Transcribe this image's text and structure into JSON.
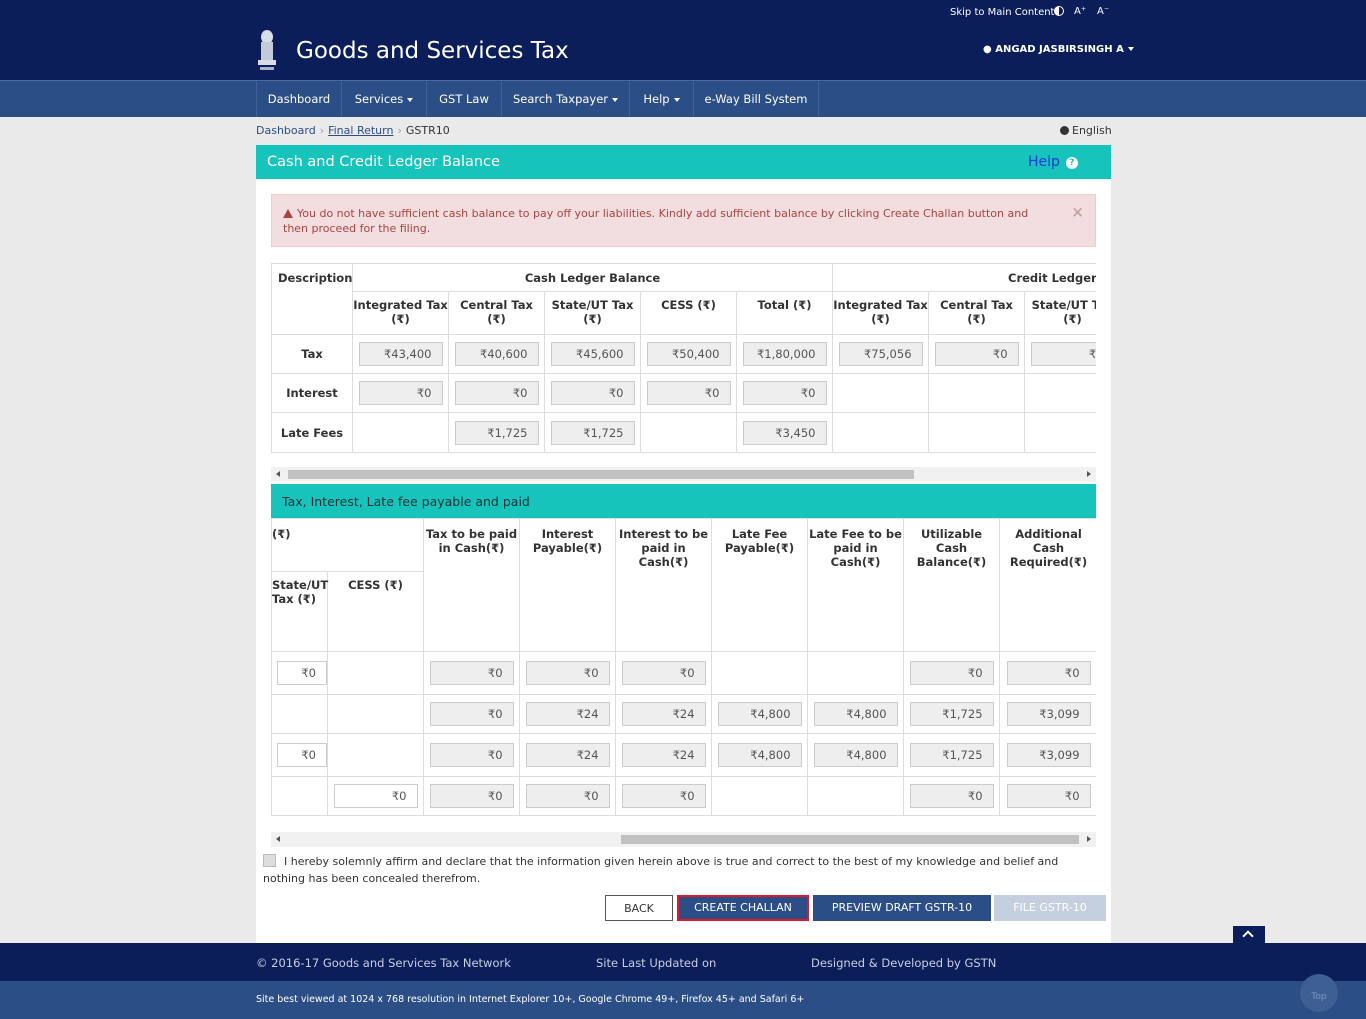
{
  "topbar": {
    "skip": "Skip to Main Content",
    "a_plus": "A⁺",
    "a_minus": "A⁻"
  },
  "header": {
    "title": "Goods and Services Tax",
    "user": "ANGAD JASBIRSINGH A"
  },
  "nav": {
    "items": [
      "Dashboard",
      "Services",
      "GST Law",
      "Search Taxpayer",
      "Help",
      "e-Way Bill System"
    ]
  },
  "breadcrumb": {
    "home": "Dashboard",
    "return": "Final Return",
    "current": "GSTR10"
  },
  "language": "English",
  "panel": {
    "title": "Cash and Credit Ledger Balance",
    "help": "Help"
  },
  "alert": {
    "message": "You do not have sufficient cash balance to pay off your liabilities. Kindly add sufficient balance by clicking Create Challan button and then proceed for the filing.",
    "close": "×"
  },
  "ledger": {
    "desc_header": "Description",
    "cash_group": "Cash Ledger Balance",
    "credit_group": "Credit Ledger Balance",
    "cash_cols": [
      "Integrated Tax (₹)",
      "Central Tax (₹)",
      "State/UT Tax (₹)",
      "CESS (₹)",
      "Total (₹)"
    ],
    "credit_cols": [
      "Integrated Tax (₹)",
      "Central Tax (₹)",
      "State/UT Tax (₹)"
    ],
    "rows": [
      {
        "label": "Tax",
        "cash": [
          "₹43,400",
          "₹40,600",
          "₹45,600",
          "₹50,400",
          "₹1,80,000"
        ],
        "credit": [
          "₹75,056",
          "₹0",
          "₹0"
        ]
      },
      {
        "label": "Interest",
        "cash": [
          "₹0",
          "₹0",
          "₹0",
          "₹0",
          "₹0"
        ],
        "credit": [
          "",
          "",
          ""
        ]
      },
      {
        "label": "Late Fees",
        "cash": [
          "",
          "₹1,725",
          "₹1,725",
          "",
          "₹3,450"
        ],
        "credit": [
          "",
          "",
          ""
        ]
      }
    ]
  },
  "payable": {
    "title": "Tax, Interest, Late fee payable and paid",
    "group_fragment": "(₹)",
    "sub_cols": [
      "State/UT Tax (₹)",
      "CESS (₹)"
    ],
    "cols": [
      "Tax to be paid in Cash(₹)",
      "Interest Payable(₹)",
      "Interest to be paid in Cash(₹)",
      "Late Fee Payable(₹)",
      "Late Fee to be paid in Cash(₹)",
      "Utilizable Cash Balance(₹)",
      "Additional Cash Required(₹)"
    ],
    "rows": [
      {
        "state": "₹0",
        "cess": "",
        "vals": [
          "₹0",
          "₹0",
          "₹0",
          "",
          "",
          "₹0",
          "₹0"
        ]
      },
      {
        "state": "",
        "cess": "",
        "vals": [
          "₹0",
          "₹24",
          "₹24",
          "₹4,800",
          "₹4,800",
          "₹1,725",
          "₹3,099"
        ]
      },
      {
        "state": "₹0",
        "cess": "",
        "vals": [
          "₹0",
          "₹24",
          "₹24",
          "₹4,800",
          "₹4,800",
          "₹1,725",
          "₹3,099"
        ]
      },
      {
        "state": "",
        "cess": "₹0",
        "vals": [
          "₹0",
          "₹0",
          "₹0",
          "",
          "",
          "₹0",
          "₹0"
        ]
      }
    ]
  },
  "declaration": "I hereby solemnly affirm and declare that the information given herein above is true and correct to the best of my knowledge and belief and nothing has been concealed therefrom.",
  "buttons": {
    "back": "BACK",
    "challan": "CREATE CHALLAN",
    "preview": "PREVIEW DRAFT GSTR-10",
    "file": "FILE GSTR-10"
  },
  "footer": {
    "copyright": "© 2016-17 Goods and Services Tax Network",
    "updated": "Site Last Updated on",
    "designed": "Designed & Developed by GSTN",
    "best_viewed": "Site best viewed at 1024 x 768 resolution in Internet Explorer 10+, Google Chrome 49+, Firefox 45+ and Safari 6+",
    "top": "Top"
  },
  "colors": {
    "navy": "#0b1e59",
    "nav_blue": "#2c4e86",
    "teal": "#17c4bb",
    "alert_red": "#a94442",
    "highlight": "#e0182d"
  }
}
